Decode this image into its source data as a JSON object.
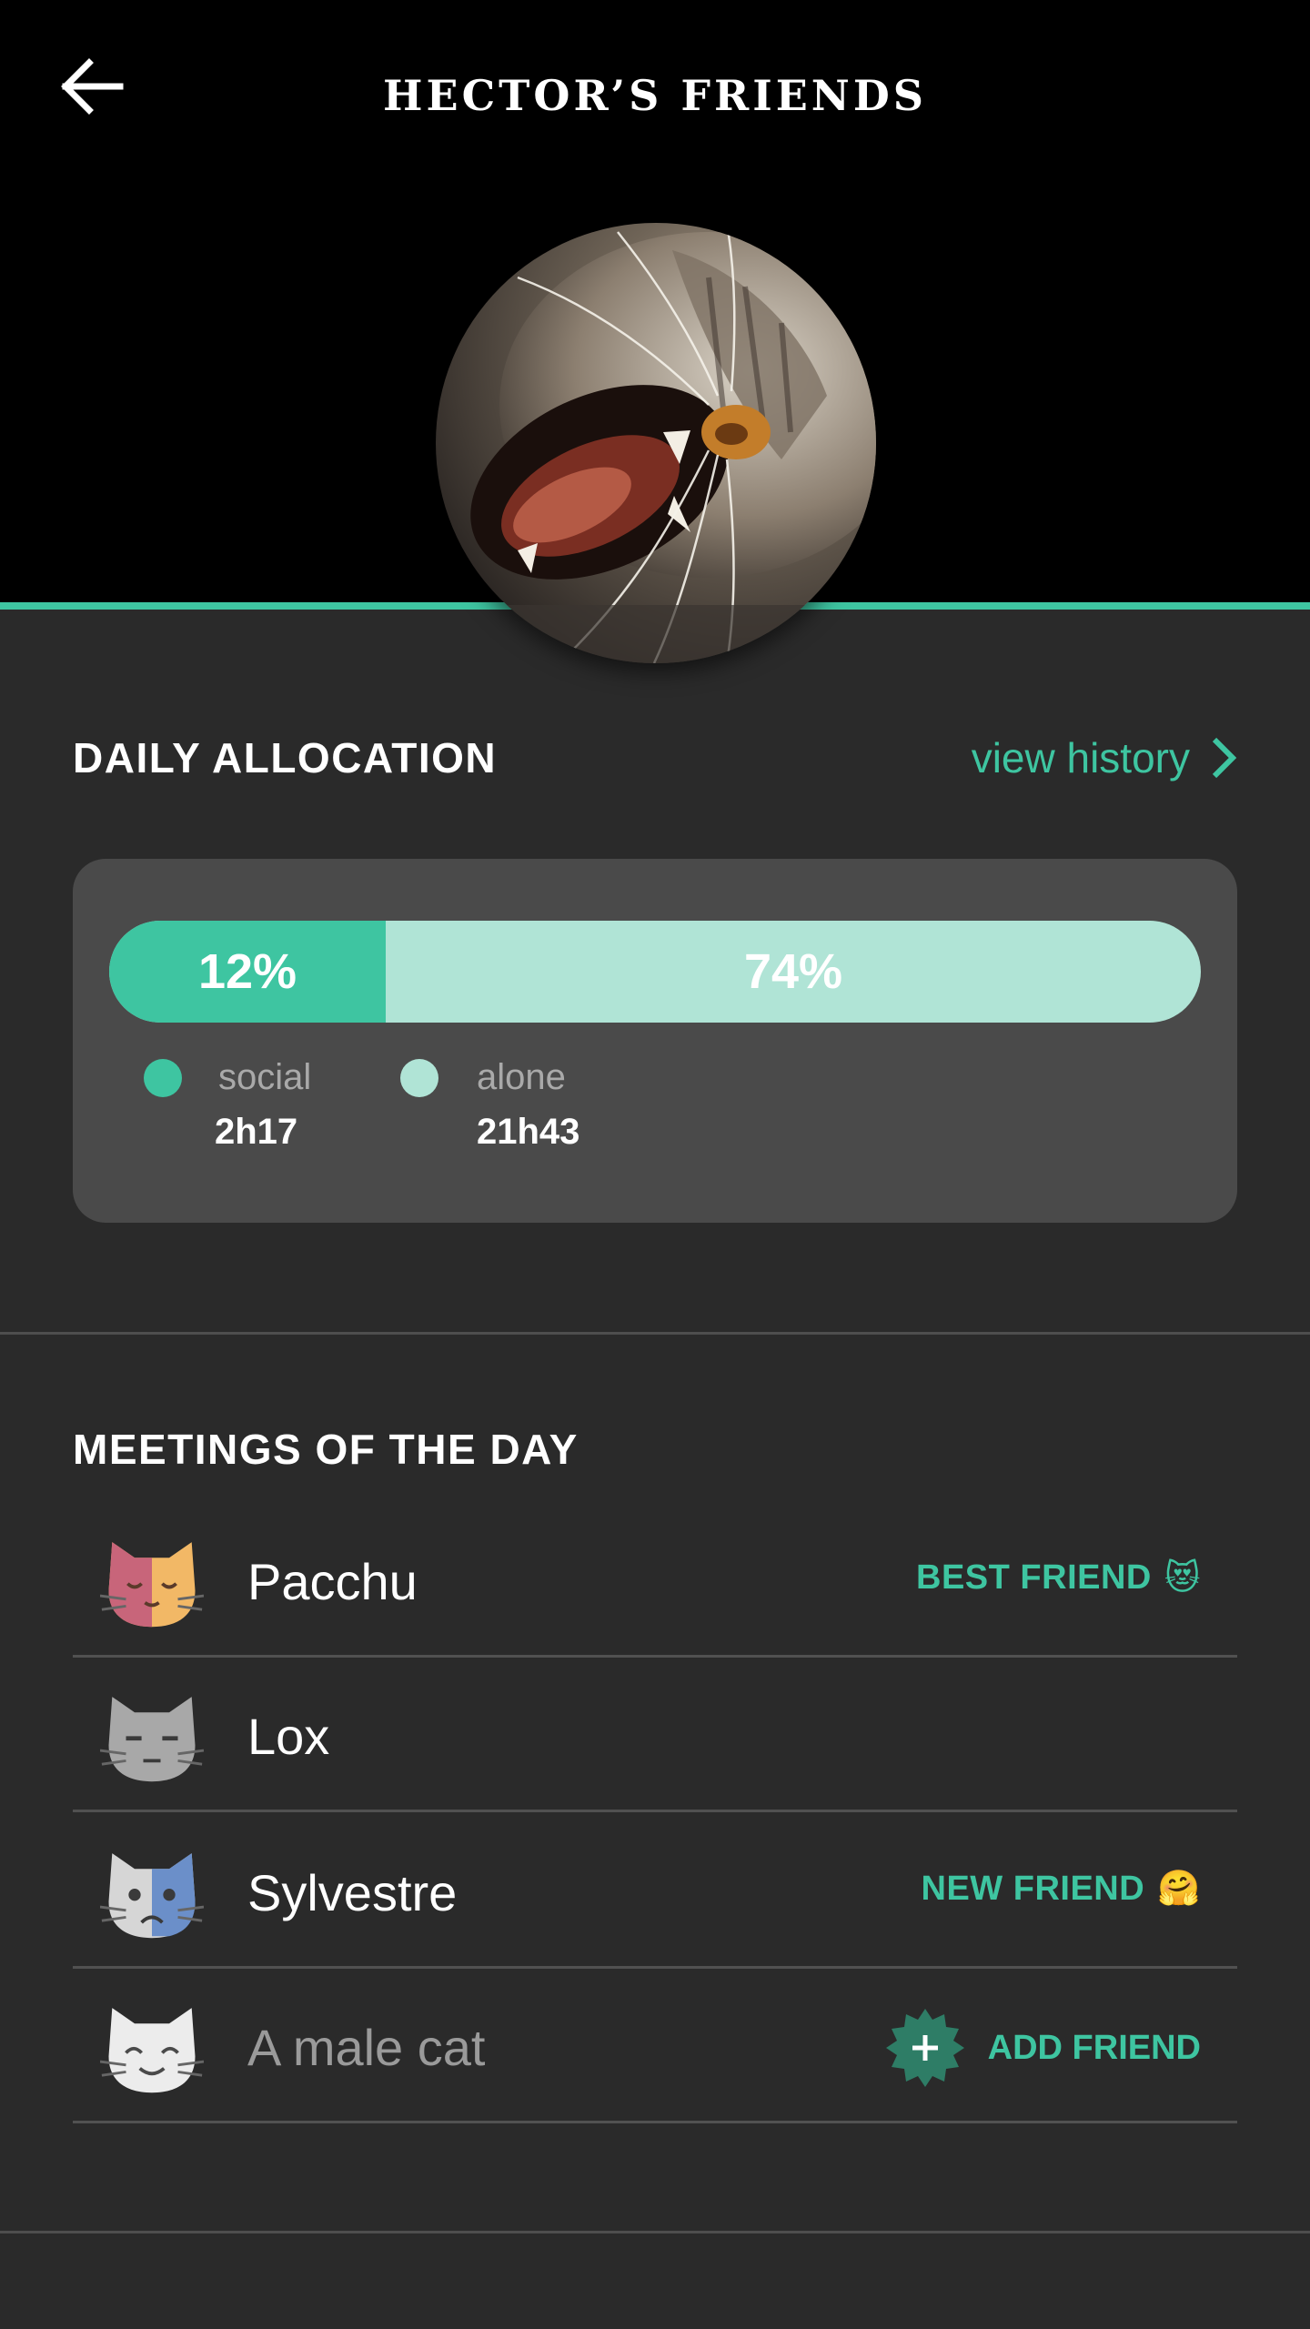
{
  "header": {
    "title": "HECTOR’S FRIENDS",
    "back_icon": "arrow-left-icon"
  },
  "colors": {
    "accent": "#3ec5a1",
    "accent_light": "#b0e4d6",
    "add_badge": "#2e7d66",
    "background": "#2a2a2a",
    "card": "#4a4a4a"
  },
  "daily_allocation": {
    "title": "DAILY ALLOCATION",
    "view_history_label": "view history",
    "social": {
      "percent_label": "12%",
      "fraction": 0.253,
      "label": "social",
      "value": "2h17"
    },
    "alone": {
      "percent_label": "74%",
      "label": "alone",
      "value": "21h43"
    }
  },
  "meetings": {
    "title": "MEETINGS OF THE DAY",
    "items": [
      {
        "name": "Pacchu",
        "status": "BEST FRIEND",
        "status_emoji": "😻",
        "avatar": "cat-sleepy-icon"
      },
      {
        "name": "Lox",
        "status": "",
        "status_emoji": "",
        "avatar": "cat-unamused-icon"
      },
      {
        "name": "Sylvestre",
        "status": "NEW FRIEND",
        "status_emoji": "🤗",
        "avatar": "cat-worried-icon"
      },
      {
        "name": "A male cat",
        "action": "ADD FRIEND",
        "avatar": "cat-happy-icon"
      }
    ]
  }
}
